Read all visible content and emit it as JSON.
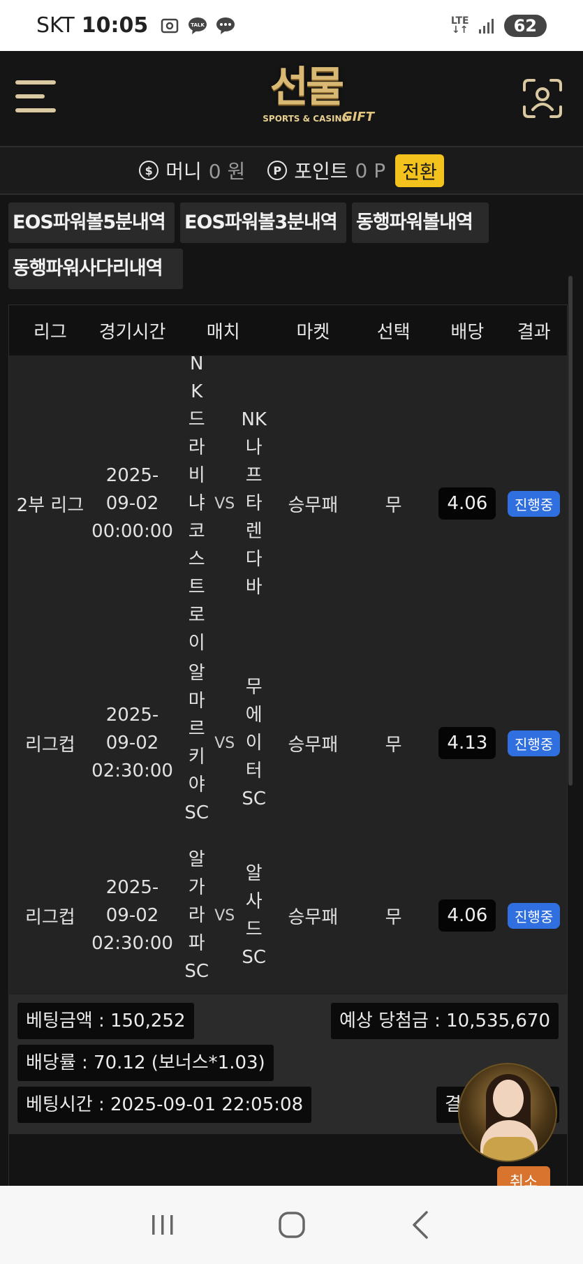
{
  "status_bar": {
    "carrier": "SKT",
    "time": "10:05",
    "network": "LTE",
    "battery": "62",
    "notif_talk": "TALK"
  },
  "header": {
    "logo_text": "선물",
    "logo_gift": "GIFT",
    "logo_sub": "SPORTS & CASINO"
  },
  "wallet": {
    "money_icon": "$",
    "money_label": "머니",
    "money_value": "0 원",
    "point_icon": "P",
    "point_label": "포인트",
    "point_value": "0 P",
    "convert_label": "전환"
  },
  "tabs": [
    "EOS파워볼5분내역",
    "EOS파워볼3분내역",
    "동행파워볼내역",
    "동행파워사다리내역"
  ],
  "table": {
    "headers": [
      "리그",
      "경기시간",
      "매치",
      "마켓",
      "선택",
      "배당",
      "결과"
    ],
    "rows": [
      {
        "league": "2부 리그",
        "time": "2025-09-02 00:00:00",
        "home": "NK드라비냐코스트로이",
        "vs": "VS",
        "away": "NK나프타렌다바",
        "market": "승무패",
        "pick": "무",
        "odds": "4.06",
        "result": "진행중"
      },
      {
        "league": "리그컵",
        "time": "2025-09-02 02:30:00",
        "home": "알마르키야SC",
        "vs": "VS",
        "away": "무에이터SC",
        "market": "승무패",
        "pick": "무",
        "odds": "4.13",
        "result": "진행중"
      },
      {
        "league": "리그컵",
        "time": "2025-09-02 02:30:00",
        "home": "알가라파SC",
        "vs": "VS",
        "away": "알사드SC",
        "market": "승무패",
        "pick": "무",
        "odds": "4.06",
        "result": "진행중"
      }
    ]
  },
  "summary": {
    "bet_amount": "베팅금액 : 150,252",
    "expected_win": "예상 당첨금 : 10,535,670",
    "odds_rate": "배당률 : 70.12 (보너스*1.03)",
    "bet_time": "베팅시간 : 2025-09-01 22:05:08",
    "result_partial": "결",
    "cancel_label": "취소"
  },
  "colors": {
    "accent_gold": "#d8b873",
    "convert_yellow": "#f4c21c",
    "status_blue": "#2f6fe0",
    "cancel_orange": "#d8742e"
  }
}
